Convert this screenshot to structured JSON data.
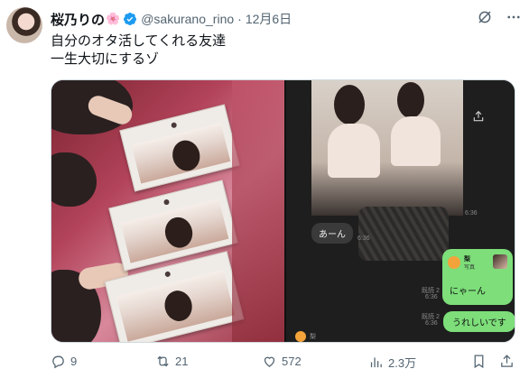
{
  "user": {
    "display_name": "桜乃りの",
    "name_emoji": "🌸",
    "handle": "@sakurano_rino",
    "separator": "·",
    "date": "12月6日"
  },
  "tweet": {
    "line1": "自分のオタ活してくれる友達",
    "line2": "一生大切にするゾ"
  },
  "chat": {
    "msg_in": "あーん",
    "msg_in_time": "6:36",
    "photo_time": "6:36",
    "card_name": "梨",
    "card_sub": "写真",
    "card_text": "にゃーん",
    "card_read": "既読 2",
    "card_time": "6:36",
    "msg_out": "うれしいです",
    "msg_out_read": "既読 2",
    "msg_out_time": "6:36",
    "bottom_name": "梨"
  },
  "metrics": {
    "replies": "9",
    "reposts": "21",
    "likes": "572",
    "views": "2.3万"
  },
  "icons": {
    "verified": "verified-badge-icon",
    "grok": "grok-icon",
    "more": "more-icon",
    "reply": "reply-icon",
    "repost": "repost-icon",
    "like": "heart-icon",
    "views": "views-icon",
    "bookmark": "bookmark-icon",
    "share": "share-icon"
  },
  "colors": {
    "verified": "#1d9bf0",
    "muted": "#536471",
    "chat_bubble_out": "#7dde7a"
  }
}
